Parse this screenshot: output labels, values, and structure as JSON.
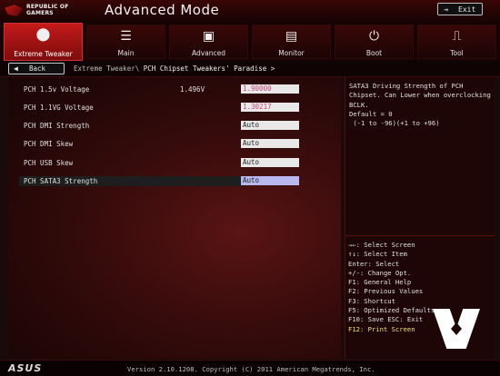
{
  "header": {
    "logo_line1": "REPUBLIC OF",
    "logo_line2": "GAMERS",
    "mode_title": "Advanced Mode",
    "exit_label": "Exit"
  },
  "tabs": [
    {
      "label": "Extreme Tweaker",
      "icon": "⬤"
    },
    {
      "label": "Main",
      "icon": "☰"
    },
    {
      "label": "Advanced",
      "icon": "▣"
    },
    {
      "label": "Monitor",
      "icon": "▤"
    },
    {
      "label": "Boot",
      "icon": "⏻"
    },
    {
      "label": "Tool",
      "icon": "⎍"
    }
  ],
  "active_tab": "Extreme Tweaker",
  "breadcrumb": {
    "back_label": "Back",
    "path_prefix": "Extreme Tweaker\\",
    "current": "PCH Chipset Tweakers' Paradise >"
  },
  "settings": [
    {
      "label": "PCH 1.5v Voltage",
      "current": "1.496V",
      "value": "1.90000"
    },
    {
      "label": "PCH 1.1VG Voltage",
      "current": "",
      "value": "1.30217"
    },
    {
      "label": "PCH DMI Strength",
      "current": "",
      "value": "Auto"
    },
    {
      "label": "PCH DMI Skew",
      "current": "",
      "value": "Auto"
    },
    {
      "label": "PCH USB Skew",
      "current": "",
      "value": "Auto"
    },
    {
      "label": "PCH SATA3 Strength",
      "current": "",
      "value": "Auto"
    }
  ],
  "help": {
    "description": "SATA3 Driving Strength of PCH\nChipset. Can Lower when overclocking\nBCLK.\nDefault = 0\n (-1 to -96)(+1 to +96)",
    "keys": [
      "→←: Select Screen",
      "↑↓: Select Item",
      "Enter: Select",
      "+/-: Change Opt.",
      "F1: General Help",
      "F2: Previous Values",
      "F3: Shortcut",
      "F5: Optimized Defaults",
      "F10: Save  ESC: Exit",
      "F12: Print Screen"
    ]
  },
  "footer": {
    "brand": "ASUS",
    "version": "Version 2.10.1208. Copyright (C) 2011 American Megatrends, Inc."
  },
  "colors": {
    "accent": "#c41a1a",
    "value_pink": "#c4457a",
    "highlight_key": "#f4e26a",
    "selected_field": "#b8b8ee"
  }
}
